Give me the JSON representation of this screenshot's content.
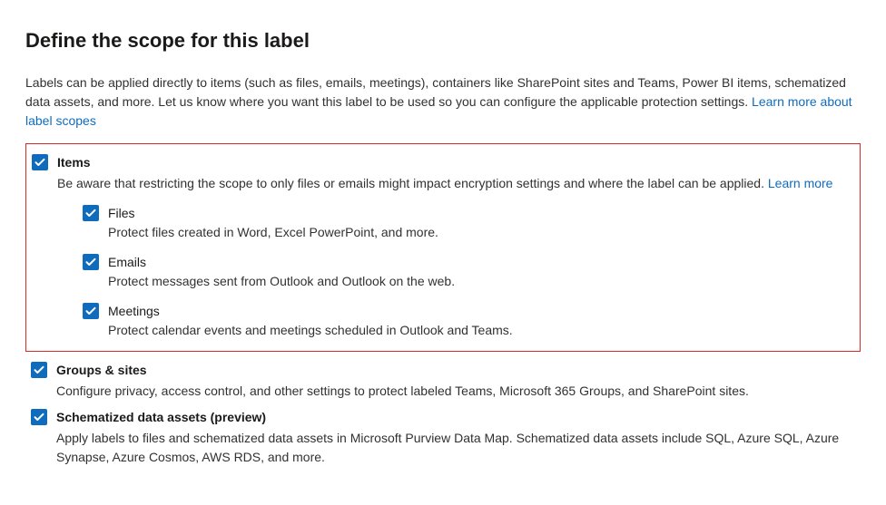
{
  "title": "Define the scope for this label",
  "intro_text": "Labels can be applied directly to items (such as files, emails, meetings), containers like SharePoint sites and Teams, Power BI items, schematized data assets, and more. Let us know where you want this label to be used so you can configure the applicable protection settings. ",
  "intro_link": "Learn more about label scopes",
  "items": {
    "label": "Items",
    "desc": "Be aware that restricting the scope to only files or emails might impact encryption settings and where the label can be applied. ",
    "learn_more": "Learn more",
    "subs": {
      "files": {
        "label": "Files",
        "desc": "Protect files created in Word, Excel PowerPoint, and more."
      },
      "emails": {
        "label": "Emails",
        "desc": "Protect messages sent from Outlook and Outlook on the web."
      },
      "meetings": {
        "label": "Meetings",
        "desc": "Protect calendar events and meetings scheduled in Outlook and Teams."
      }
    }
  },
  "groups": {
    "label": "Groups & sites",
    "desc": "Configure privacy, access control, and other settings to protect labeled Teams, Microsoft 365 Groups, and SharePoint sites."
  },
  "schematized": {
    "label": "Schematized data assets (preview)",
    "desc": "Apply labels to files and schematized data assets in Microsoft Purview Data Map. Schematized data assets include SQL, Azure SQL, Azure Synapse, Azure Cosmos, AWS RDS, and more."
  }
}
